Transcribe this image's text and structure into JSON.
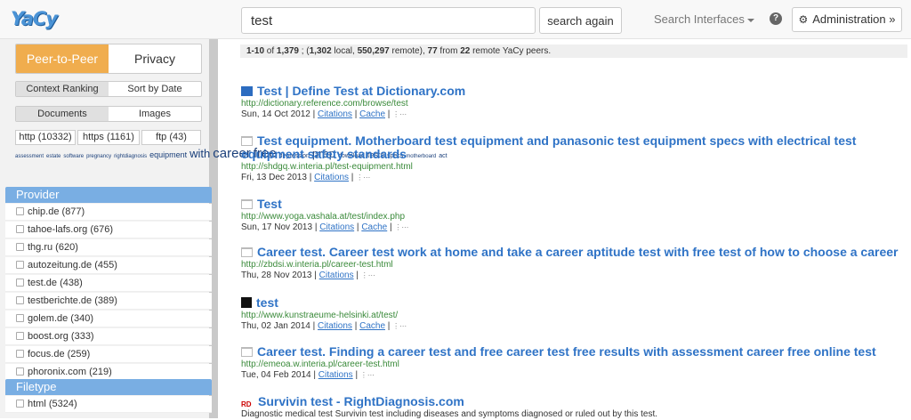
{
  "app": {
    "logo_text": "YaCy"
  },
  "search": {
    "query": "test",
    "button_label": "search again"
  },
  "nav": {
    "interfaces_label": "Search Interfaces",
    "help_label": "?",
    "admin_label": "Administration »"
  },
  "sidebar": {
    "mode_tabs": [
      "Peer-to-Peer",
      "Privacy"
    ],
    "ranking_tabs": [
      "Context Ranking",
      "Sort by Date"
    ],
    "content_tabs": [
      "Documents",
      "Images"
    ],
    "protocols": [
      "http (10332)",
      "https (1161)",
      "ftp (43)"
    ],
    "tag_cloud": [
      {
        "word": "assessment",
        "size": "s"
      },
      {
        "word": "estate",
        "size": "s"
      },
      {
        "word": "software",
        "size": "s"
      },
      {
        "word": "pregnancy",
        "size": "s"
      },
      {
        "word": "rightdiagnosis",
        "size": "s"
      },
      {
        "word": "equipment",
        "size": "m"
      },
      {
        "word": "with",
        "size": "l"
      },
      {
        "word": "career",
        "size": "xl"
      },
      {
        "word": "free",
        "size": "xl"
      },
      {
        "word": "depression",
        "size": "s2"
      },
      {
        "word": "prep",
        "size": "l"
      },
      {
        "word": "download",
        "size": "s2"
      },
      {
        "word": "tests",
        "size": "m"
      },
      {
        "word": "specs",
        "size": "s2"
      },
      {
        "word": "motherboard",
        "size": "s"
      },
      {
        "word": "act",
        "size": "s2"
      }
    ],
    "provider_title": "Provider",
    "providers": [
      "chip.de (877)",
      "tahoe-lafs.org (676)",
      "thg.ru (620)",
      "autozeitung.de (455)",
      "test.de (438)",
      "testberichte.de (389)",
      "golem.de (340)",
      "boost.org (333)",
      "focus.de (259)",
      "phoronix.com (219)"
    ],
    "filetype_title": "Filetype",
    "filetypes": [
      "html (5324)"
    ]
  },
  "status": {
    "range": "1-10",
    "total": "1,379",
    "local": "1,302",
    "remote": "550,297",
    "remote_count": "77",
    "peers": "22",
    "of": " of ",
    "sep1": " ; (",
    "local_suffix": " local, ",
    "remote_suffix": " remote), ",
    "from": " from ",
    "peers_suffix": " remote YaCy peers."
  },
  "results": [
    {
      "icon": "dictionary-icon",
      "title": "Test | Define Test at Dictionary.com",
      "url": "http://dictionary.reference.com/browse/test",
      "date": "Sun, 14 Oct 2012",
      "citations": "Citations",
      "cache": "Cache"
    },
    {
      "icon": "document-icon",
      "title": "Test equipment. Motherboard test equipment and panasonic test equipment specs with electrical test equipment safety standards",
      "url": "http://shdgq.w.interia.pl/test-equipment.html",
      "date": "Fri, 13 Dec 2013",
      "citations": "Citations",
      "cache": ""
    },
    {
      "icon": "document-icon",
      "title": "Test",
      "url": "http://www.yoga.vashala.at/test/index.php",
      "date": "Sun, 17 Nov 2013",
      "citations": "Citations",
      "cache": "Cache"
    },
    {
      "icon": "document-icon",
      "title": "Career test. Career test work at home and take a career aptitude test with free test of how to choose a career",
      "url": "http://zbdsi.w.interia.pl/career-test.html",
      "date": "Thu, 28 Nov 2013",
      "citations": "Citations",
      "cache": ""
    },
    {
      "icon": "black-square-icon",
      "title": "test",
      "url": "http://www.kunstraeume-helsinki.at/test/",
      "date": "Thu, 02 Jan 2014",
      "citations": "Citations",
      "cache": "Cache"
    },
    {
      "icon": "document-icon",
      "title": "Career test. Finding a career test and free career test free results with assessment career free online test",
      "url": "http://emeoa.w.interia.pl/career-test.html",
      "date": "Tue, 04 Feb 2014",
      "citations": "Citations",
      "cache": ""
    },
    {
      "icon": "rightdiagnosis-icon",
      "title": "Survivin test - RightDiagnosis.com",
      "snippet": "Diagnostic medical test Survivin test including diseases and symptoms diagnosed or ruled out by this test."
    }
  ],
  "colors": {
    "accent": "#f0ad4e",
    "link": "#2f73c6",
    "url": "#3a8a3a",
    "panel": "#79aee3"
  }
}
